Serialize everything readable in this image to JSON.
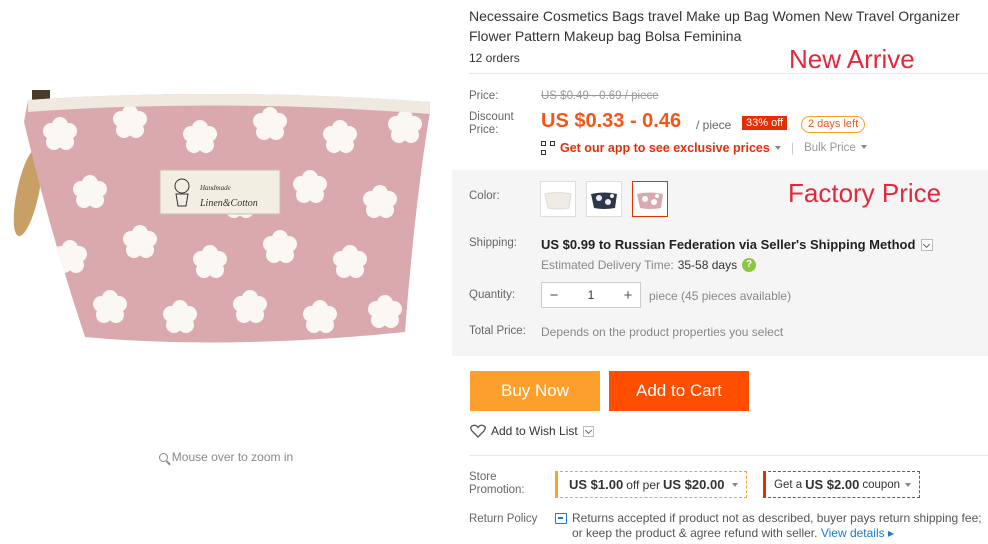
{
  "gallery": {
    "zoom_hint": "Mouse over to zoom in",
    "bag_tag_line1": "Handmade",
    "bag_tag_line2": "Linen&Cotton"
  },
  "product": {
    "title": "Necessaire Cosmetics Bags travel Make up Bag Women New Travel Organizer Flower Pattern Makeup bag Bolsa Feminina",
    "orders": "12 orders",
    "overlay_new_arrive": "New Arrive",
    "overlay_factory_price": "Factory Price"
  },
  "pricing": {
    "price_label": "Price:",
    "original_price": "US $0.49 - 0.69 / piece",
    "discount_label_line1": "Discount",
    "discount_label_line2": "Price:",
    "discount_price": "US $0.33 - 0.46",
    "unit": "/ piece",
    "discount_badge": "33% off",
    "days_left": "2 days left",
    "app_promo": "Get our app to see exclusive prices",
    "bulk_price": "Bulk Price"
  },
  "options": {
    "color_label": "Color:",
    "swatches": [
      "white-floral",
      "navy-floral",
      "pink-floral"
    ],
    "selected_swatch": 3
  },
  "shipping": {
    "label": "Shipping:",
    "method": "US $0.99 to Russian Federation via Seller's Shipping Method",
    "est_label": "Estimated Delivery Time:",
    "est_days": "35-58 days",
    "help": "?"
  },
  "quantity": {
    "label": "Quantity:",
    "minus": "−",
    "value": "1",
    "plus": "+",
    "available": "piece (45 pieces available)"
  },
  "total": {
    "label": "Total Price:",
    "note": "Depends on the product properties you select"
  },
  "actions": {
    "buy_now": "Buy Now",
    "add_to_cart": "Add to Cart",
    "wish_list": "Add to Wish List"
  },
  "store_promotion": {
    "label_line1": "Store",
    "label_line2": "Promotion:",
    "promo1_value": "US $1.00",
    "promo1_mid": "off per",
    "promo1_threshold": "US $20.00",
    "promo2_prefix": "Get a",
    "promo2_value": "US $2.00",
    "promo2_suffix": "coupon"
  },
  "return_policy": {
    "label": "Return Policy",
    "text": "Returns accepted if product not as described, buyer pays return shipping fee; or keep the product & agree refund with seller.",
    "view_details": "View details"
  },
  "colors": {
    "accent_red": "#e62e04",
    "price_orange": "#f5541a",
    "buy_button": "#fc9f2d",
    "cart_button": "#ff4e00",
    "overlay_red": "#e6263a",
    "bag_pink": "#d9a9ae"
  }
}
